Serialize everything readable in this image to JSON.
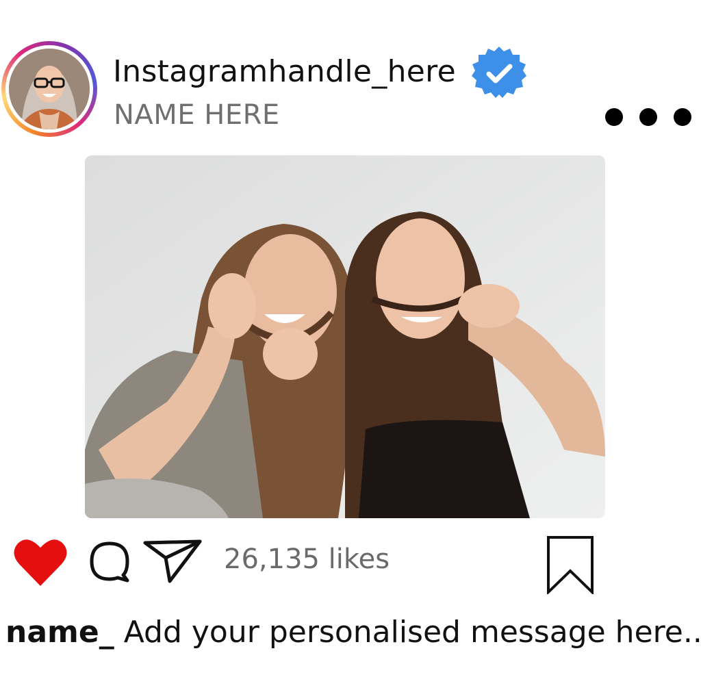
{
  "profile": {
    "handle": "Instagramhandle_here",
    "display_name": "NAME HERE",
    "verified_icon": "verified-badge-icon",
    "avatar_ring_colors": [
      "#f58529",
      "#dd2a7b",
      "#8134af",
      "#515bd4"
    ]
  },
  "menu": {
    "icon": "more-options-icon"
  },
  "post": {
    "image": "photo-two-women-laughing"
  },
  "actions": {
    "like_icon": "heart-icon",
    "like_color": "#e60f0f",
    "comment_icon": "comment-icon",
    "share_icon": "share-icon",
    "likes_text": "26,135 likes",
    "bookmark_icon": "bookmark-icon"
  },
  "caption": {
    "username": "name_",
    "message": "Add your personalised message here..."
  },
  "colors": {
    "verified_blue": "#3d8fe8",
    "muted_text": "#6f6f6f"
  }
}
